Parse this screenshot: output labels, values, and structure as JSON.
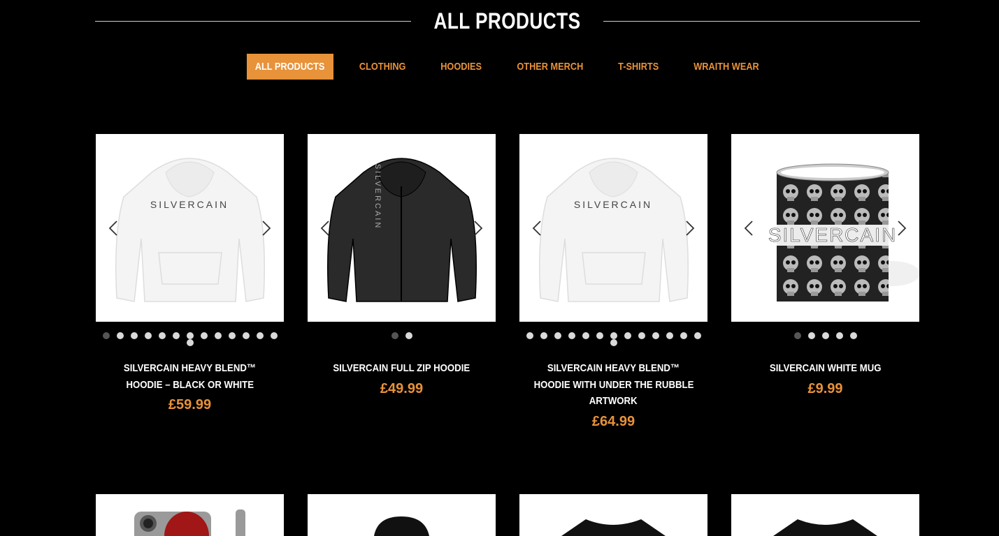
{
  "page": {
    "title": "ALL PRODUCTS"
  },
  "filters": [
    {
      "label": "ALL PRODUCTS",
      "active": true
    },
    {
      "label": "CLOTHING",
      "active": false
    },
    {
      "label": "HOODIES",
      "active": false
    },
    {
      "label": "OTHER MERCH",
      "active": false
    },
    {
      "label": "T-SHIRTS",
      "active": false
    },
    {
      "label": "WRAITH WEAR",
      "active": false
    }
  ],
  "products": [
    {
      "name_lines": [
        "SILVERCAIN HEAVY BLEND™",
        "HOODIE – BLACK OR WHITE"
      ],
      "price": "£59.99",
      "image": "white-hoodie",
      "image_text": "SILVERCAIN",
      "slide_count": 14,
      "active_slide": 0
    },
    {
      "name_lines": [
        "SILVERCAIN FULL ZIP HOODIE"
      ],
      "price": "£49.99",
      "image": "black-zip-hoodie",
      "image_text": "SILVERCAIN",
      "slide_count": 2,
      "active_slide": 0
    },
    {
      "name_lines": [
        "SILVERCAIN HEAVY BLEND™",
        "HOODIE WITH UNDER THE RUBBLE",
        "ARTWORK"
      ],
      "price": "£64.99",
      "image": "white-hoodie",
      "image_text": "SILVERCAIN",
      "slide_count": 14,
      "active_slide": -1
    },
    {
      "name_lines": [
        "SILVERCAIN WHITE MUG"
      ],
      "price": "£9.99",
      "image": "skull-mug",
      "image_text": "SILVERCAIN",
      "slide_count": 5,
      "active_slide": 0
    }
  ],
  "row2": [
    {
      "image": "phone-case"
    },
    {
      "image": "black-hoodie"
    },
    {
      "image": "black-tshirt"
    },
    {
      "image": "black-tshirt"
    }
  ],
  "colors": {
    "accent": "#e8923a",
    "background": "#000000"
  }
}
